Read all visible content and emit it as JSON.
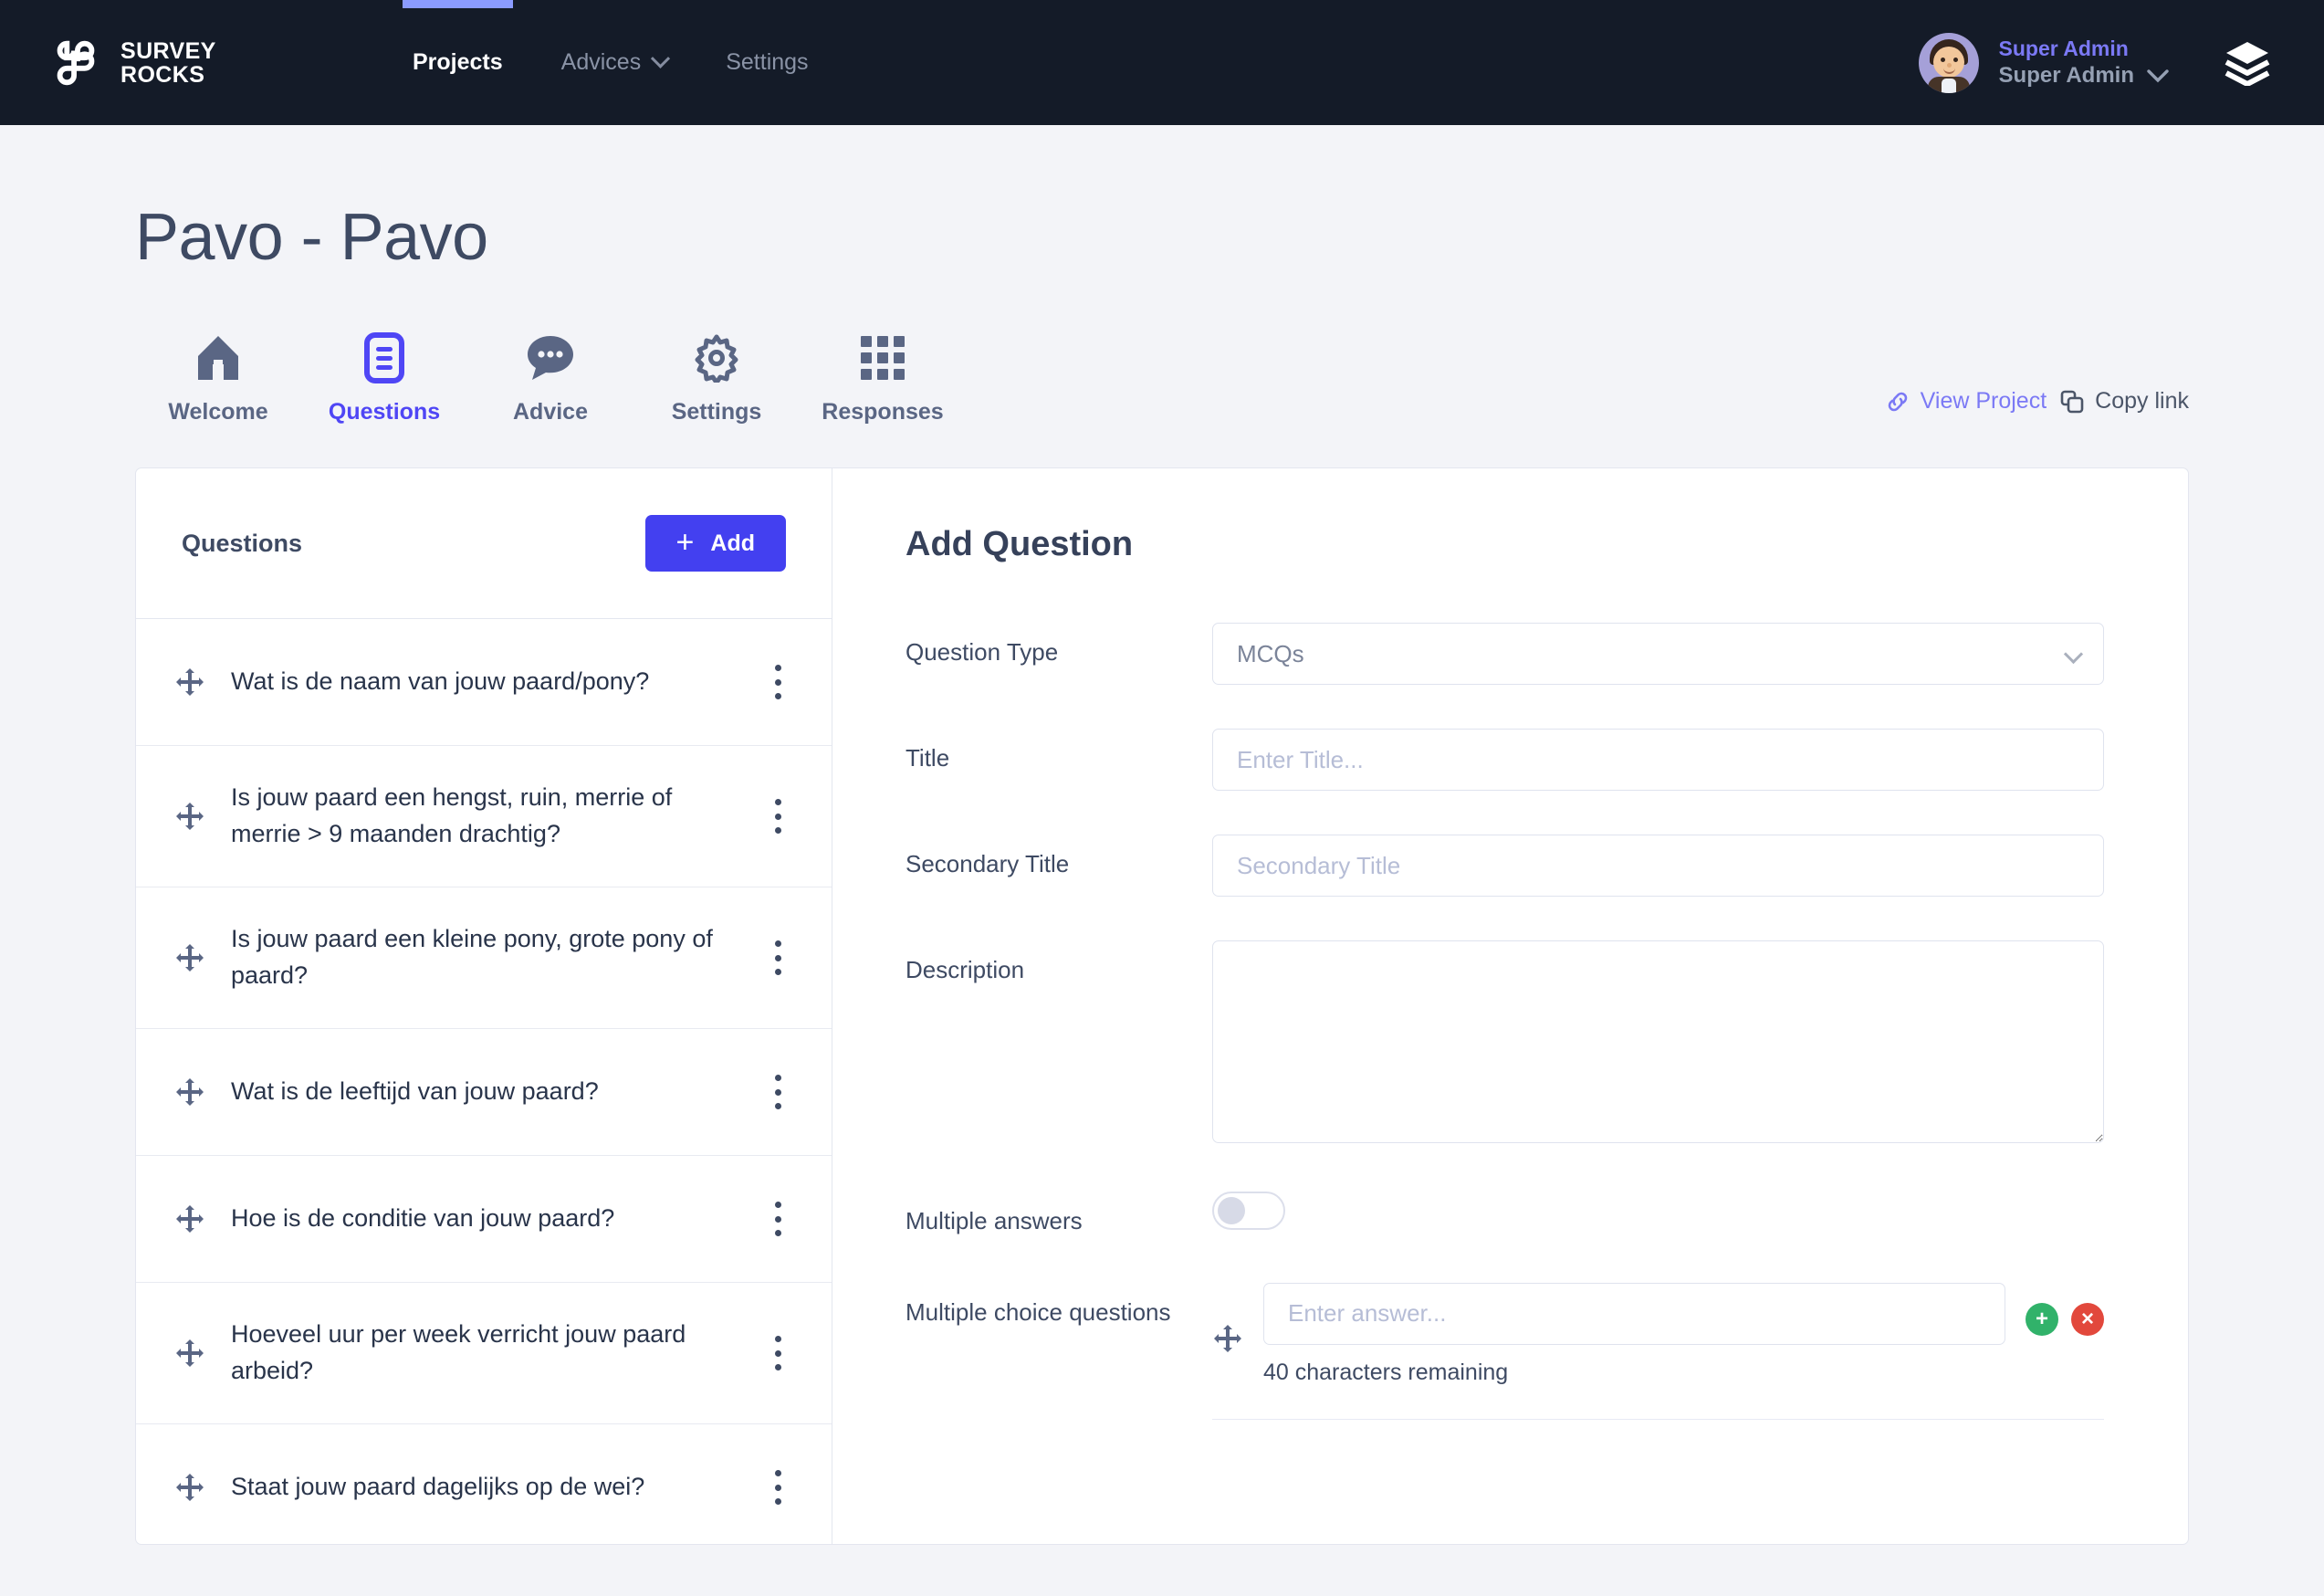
{
  "brand": {
    "line1": "SURVEY",
    "line2": "ROCKS",
    "logo_icon": "knot-logo-icon"
  },
  "topnav": {
    "items": [
      {
        "label": "Projects",
        "active": true,
        "has_caret": false
      },
      {
        "label": "Advices",
        "active": false,
        "has_caret": true
      },
      {
        "label": "Settings",
        "active": false,
        "has_caret": false
      }
    ],
    "accent_color": "#8b9bff",
    "background": "#141b28"
  },
  "user": {
    "role": "Super Admin",
    "name": "Super Admin",
    "role_color": "#7b79f5",
    "avatar_icon": "avatar",
    "caret_icon": "chevron-down-icon",
    "layers_icon": "layers-icon"
  },
  "page": {
    "title": "Pavo - Pavo"
  },
  "project_tabs": {
    "items": [
      {
        "label": "Welcome",
        "icon": "home-icon",
        "active": false
      },
      {
        "label": "Questions",
        "icon": "document-icon",
        "active": true
      },
      {
        "label": "Advice",
        "icon": "chat-bubble-icon",
        "active": false
      },
      {
        "label": "Settings",
        "icon": "gear-icon",
        "active": false
      },
      {
        "label": "Responses",
        "icon": "grid-icon",
        "active": false
      }
    ],
    "active_color": "#4f46f5",
    "inactive_color": "#5a6684"
  },
  "links": {
    "view_project": "View Project",
    "copy_link": "Copy link",
    "view_project_icon": "link-icon",
    "copy_link_icon": "copy-icon"
  },
  "questions_panel": {
    "heading": "Questions",
    "add_label": "Add",
    "add_icon": "plus-icon",
    "add_color": "#4340f0",
    "items": [
      {
        "text": "Wat is de naam van jouw paard/pony?",
        "tall": false
      },
      {
        "text": "Is jouw paard een hengst, ruin, merrie of merrie > 9 maanden drachtig?",
        "tall": true
      },
      {
        "text": "Is jouw paard een kleine pony, grote pony of paard?",
        "tall": true
      },
      {
        "text": "Wat is de leeftijd van jouw paard?",
        "tall": false
      },
      {
        "text": "Hoe is de conditie van jouw paard?",
        "tall": false
      },
      {
        "text": "Hoeveel uur per week verricht jouw paard arbeid?",
        "tall": true
      },
      {
        "text": "Staat jouw paard dagelijks op de wei?",
        "tall": false
      }
    ],
    "drag_icon": "drag-move-icon",
    "menu_icon": "kebab-menu-icon"
  },
  "form": {
    "title": "Add Question",
    "question_type": {
      "label": "Question Type",
      "value": "MCQs",
      "options": [
        "MCQs"
      ]
    },
    "title_field": {
      "label": "Title",
      "value": "",
      "placeholder": "Enter Title..."
    },
    "secondary_title": {
      "label": "Secondary Title",
      "value": "",
      "placeholder": "Secondary Title"
    },
    "description": {
      "label": "Description",
      "value": "",
      "placeholder": ""
    },
    "multiple_answers": {
      "label": "Multiple answers",
      "enabled": false
    },
    "mcq": {
      "label": "Multiple choice questions",
      "answer_value": "",
      "answer_placeholder": "Enter answer...",
      "char_note": "40 characters remaining",
      "add_label": "+",
      "delete_label": "×",
      "add_color": "#31b26a",
      "delete_color": "#e2483c"
    }
  }
}
